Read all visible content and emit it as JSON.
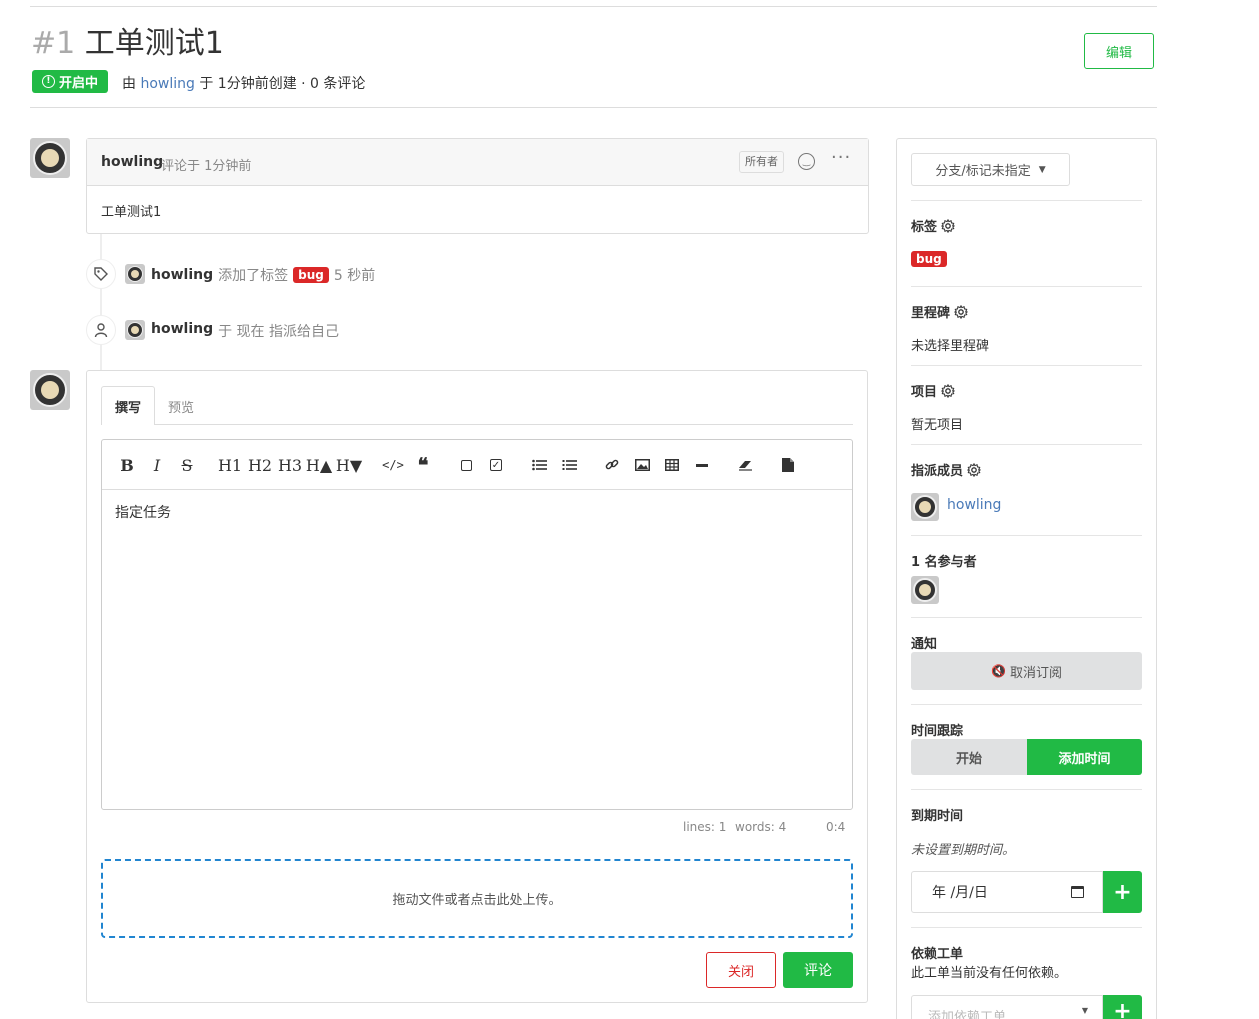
{
  "issue": {
    "number": "#1",
    "title": "工单测试1",
    "status": "开启中",
    "meta_by": "由",
    "author": "howling",
    "meta_created": "于 1分钟前创建 · 0 条评论",
    "edit_label": "编辑"
  },
  "comment": {
    "author": "howling",
    "time": "评论于 1分钟前",
    "role_badge": "所有者",
    "body": "工单测试1"
  },
  "events": [
    {
      "author": "howling",
      "text": "添加了标签",
      "label": "bug",
      "time": "5 秒前"
    },
    {
      "author": "howling",
      "text": "于 现在 指派给自己"
    }
  ],
  "editor": {
    "tab_write": "撰写",
    "tab_preview": "预览",
    "content": "指定任务",
    "status_lines": "lines: 1",
    "status_words": "words: 4",
    "status_cursor": "0:4",
    "upload_hint": "拖动文件或者点击此处上传。",
    "close_label": "关闭",
    "comment_label": "评论",
    "toolbar": [
      "B",
      "I",
      "S",
      "H1",
      "H2",
      "H3",
      "H▲",
      "H▼"
    ]
  },
  "sidebar": {
    "branch_dropdown": "分支/标记未指定",
    "labels_title": "标签",
    "label_bug": "bug",
    "milestone_title": "里程碑",
    "milestone_value": "未选择里程碑",
    "projects_title": "项目",
    "projects_value": "暂无项目",
    "assignees_title": "指派成员",
    "assignee_name": "howling",
    "participants_title": "1 名参与者",
    "notify_title": "通知",
    "unsubscribe_label": "取消订阅",
    "time_tracking_title": "时间跟踪",
    "start_label": "开始",
    "add_time_label": "添加时间",
    "due_title": "到期时间",
    "due_value": "未设置到期时间。",
    "date_placeholder": "年 /月/日",
    "deps_title": "依赖工单",
    "deps_value": "此工单当前没有任何依赖。",
    "deps_placeholder": "添加依赖工单..."
  },
  "colors": {
    "green": "#21ba45",
    "red": "#db2828",
    "link": "#4a7ab8",
    "upload_border": "#2185d0"
  }
}
